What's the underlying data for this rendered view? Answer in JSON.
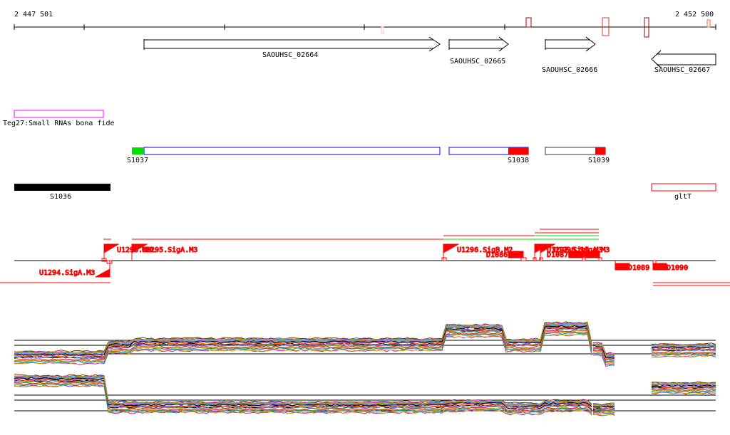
{
  "ruler": {
    "start_label": "2 447 501",
    "end_label": "2 452 500"
  },
  "genes": [
    {
      "name": "SAOUHSC_02664",
      "strand": "+"
    },
    {
      "name": "SAOUHSC_02665",
      "strand": "+"
    },
    {
      "name": "SAOUHSC_02666",
      "strand": "+"
    },
    {
      "name": "SAOUHSC_02667",
      "strand": "-"
    }
  ],
  "small_rna": {
    "label": "Teg27:Small RNAs bona fide"
  },
  "segments": {
    "s1037": "S1037",
    "s1038": "S1038",
    "s1039": "S1039",
    "s1036": "S1036",
    "gltT": "gltT"
  },
  "promoters": {
    "u1293": "U1293.NML",
    "u1295": "U1295.SigA.M3",
    "u1294": "U1294.SigA.M3",
    "u1296": "U1296.SigB.M2",
    "u1297": "U1297.SigA.M3",
    "u1298": "U1298.SigA.M3"
  },
  "terminators": {
    "d1086": "D1086",
    "d1087": "D1087",
    "d1088": "D1088",
    "d1089": "D1089",
    "d1090": "D1090"
  },
  "colors": {
    "feature_red": "#ff0000",
    "green": "#00e000",
    "blue": "#0000ff",
    "magenta": "#ff00ff"
  }
}
